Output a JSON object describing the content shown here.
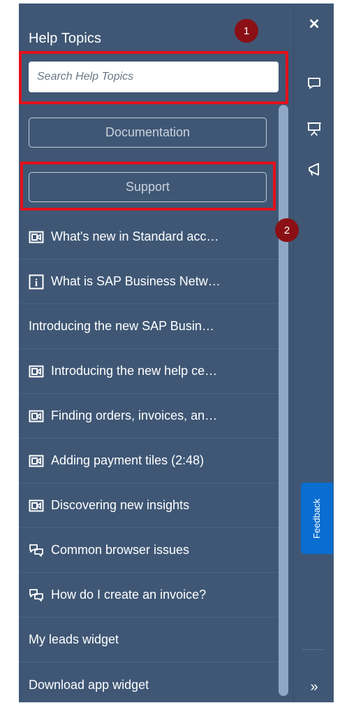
{
  "header": {
    "title": "Help Topics"
  },
  "search": {
    "placeholder": "Search Help Topics"
  },
  "annotations": {
    "badge1": "1",
    "badge2": "2"
  },
  "buttons": {
    "documentation": "Documentation",
    "support": "Support"
  },
  "topics": [
    {
      "icon": "video-icon",
      "label": "What's new in Standard acc…"
    },
    {
      "icon": "info-icon",
      "label": "What is SAP Business Netw…"
    },
    {
      "icon": "",
      "label": "Introducing the new SAP Busin…"
    },
    {
      "icon": "video-icon",
      "label": "Introducing the new help ce…"
    },
    {
      "icon": "video-icon",
      "label": "Finding orders, invoices, an…"
    },
    {
      "icon": "video-icon",
      "label": "Adding payment tiles (2:48)"
    },
    {
      "icon": "video-icon",
      "label": "Discovering new insights"
    },
    {
      "icon": "chat-bubbles-icon",
      "label": "Common browser issues"
    },
    {
      "icon": "chat-bubbles-icon",
      "label": "How do I create an invoice?"
    },
    {
      "icon": "",
      "label": "My leads widget"
    },
    {
      "icon": "",
      "label": "Download app widget"
    }
  ],
  "rail": {
    "feedback_label": "Feedback"
  },
  "colors": {
    "panel": "#3f5775",
    "highlight": "#e3101a",
    "badge": "#8a1015",
    "feedback": "#0a6ed1"
  }
}
